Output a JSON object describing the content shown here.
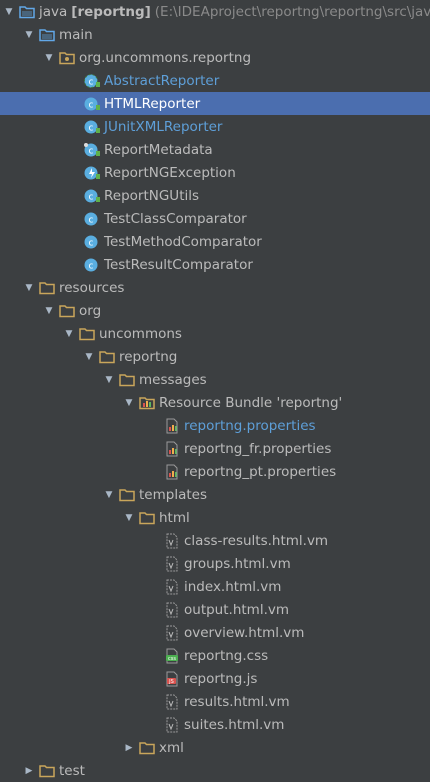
{
  "tree": [
    {
      "id": "root",
      "depth": 0,
      "arrow": "down",
      "icon": "module",
      "label": "java",
      "bold_suffix": "[reportng]",
      "path": "(E:\\IDEAproject\\reportng\\reportng\\src\\java"
    },
    {
      "id": "main",
      "depth": 1,
      "arrow": "down",
      "icon": "source-folder",
      "label": "main"
    },
    {
      "id": "pkg",
      "depth": 2,
      "arrow": "down",
      "icon": "package",
      "label": "org.uncommons.reportng"
    },
    {
      "id": "AbstractReporter",
      "depth": 4,
      "icon": "abstract-class",
      "label": "AbstractReporter",
      "style": "blue"
    },
    {
      "id": "HTMLReporter",
      "depth": 4,
      "icon": "class",
      "label": "HTMLReporter",
      "selected": true
    },
    {
      "id": "JUnitXMLReporter",
      "depth": 4,
      "icon": "class",
      "label": "JUnitXMLReporter",
      "style": "blue"
    },
    {
      "id": "ReportMetadata",
      "depth": 4,
      "icon": "class-final",
      "label": "ReportMetadata"
    },
    {
      "id": "ReportNGException",
      "depth": 4,
      "icon": "exception",
      "label": "ReportNGException"
    },
    {
      "id": "ReportNGUtils",
      "depth": 4,
      "icon": "class",
      "label": "ReportNGUtils"
    },
    {
      "id": "TestClassComparator",
      "depth": 4,
      "icon": "class-package",
      "label": "TestClassComparator"
    },
    {
      "id": "TestMethodComparator",
      "depth": 4,
      "icon": "class-package",
      "label": "TestMethodComparator"
    },
    {
      "id": "TestResultComparator",
      "depth": 4,
      "icon": "class-package",
      "label": "TestResultComparator"
    },
    {
      "id": "resources",
      "depth": 1,
      "arrow": "down",
      "icon": "folder",
      "label": "resources"
    },
    {
      "id": "org",
      "depth": 2,
      "arrow": "down",
      "icon": "folder",
      "label": "org"
    },
    {
      "id": "uncommons",
      "depth": 3,
      "arrow": "down",
      "icon": "folder",
      "label": "uncommons"
    },
    {
      "id": "reportng",
      "depth": 4,
      "arrow": "down",
      "icon": "folder",
      "label": "reportng"
    },
    {
      "id": "messages",
      "depth": 5,
      "arrow": "down",
      "icon": "folder",
      "label": "messages"
    },
    {
      "id": "bundle",
      "depth": 6,
      "arrow": "down",
      "icon": "resource-bundle",
      "label": "Resource Bundle 'reportng'"
    },
    {
      "id": "prop1",
      "depth": 8,
      "icon": "properties-file",
      "label": "reportng.properties",
      "style": "blue"
    },
    {
      "id": "prop2",
      "depth": 8,
      "icon": "properties-file",
      "label": "reportng_fr.properties"
    },
    {
      "id": "prop3",
      "depth": 8,
      "icon": "properties-file",
      "label": "reportng_pt.properties"
    },
    {
      "id": "templates",
      "depth": 5,
      "arrow": "down",
      "icon": "folder",
      "label": "templates"
    },
    {
      "id": "html",
      "depth": 6,
      "arrow": "down",
      "icon": "folder",
      "label": "html"
    },
    {
      "id": "vm1",
      "depth": 8,
      "icon": "velocity-file",
      "label": "class-results.html.vm"
    },
    {
      "id": "vm2",
      "depth": 8,
      "icon": "velocity-file",
      "label": "groups.html.vm"
    },
    {
      "id": "vm3",
      "depth": 8,
      "icon": "velocity-file",
      "label": "index.html.vm"
    },
    {
      "id": "vm4",
      "depth": 8,
      "icon": "velocity-file",
      "label": "output.html.vm"
    },
    {
      "id": "vm5",
      "depth": 8,
      "icon": "velocity-file",
      "label": "overview.html.vm"
    },
    {
      "id": "css",
      "depth": 8,
      "icon": "css-file",
      "label": "reportng.css"
    },
    {
      "id": "js",
      "depth": 8,
      "icon": "js-file",
      "label": "reportng.js"
    },
    {
      "id": "vm6",
      "depth": 8,
      "icon": "velocity-file",
      "label": "results.html.vm"
    },
    {
      "id": "vm7",
      "depth": 8,
      "icon": "velocity-file",
      "label": "suites.html.vm"
    },
    {
      "id": "xml",
      "depth": 6,
      "arrow": "right",
      "icon": "folder",
      "label": "xml"
    },
    {
      "id": "test",
      "depth": 1,
      "arrow": "right",
      "icon": "folder",
      "label": "test"
    }
  ],
  "colors": {
    "folder": "#c9a65b",
    "source_folder": "#62a8e8",
    "class_circle": "#5aaee0",
    "abstract_circle": "#5aaee0",
    "lock_green": "#5fb14b",
    "exception": "#5aaee0",
    "selection": "#4b6eaf"
  }
}
